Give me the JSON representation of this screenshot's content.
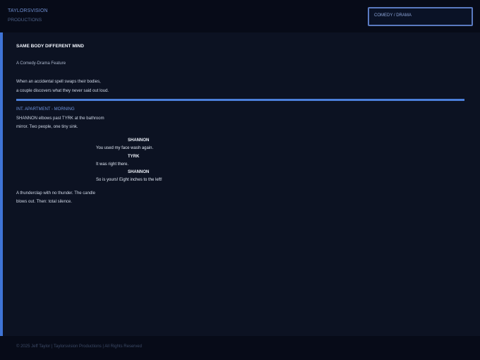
{
  "header": {
    "brand_line1": "TAYLORSVISION",
    "brand_line2": "PRODUCTIONS",
    "genre": "COMEDY / DRAMA"
  },
  "script": {
    "title": "SAME BODY DIFFERENT MIND",
    "subtitle": "A Comedy-Drama Feature",
    "logline": [
      "When an accidental spell swaps their bodies,",
      "a couple discovers what they never said out loud."
    ],
    "slugline": "INT. APARTMENT - MORNING",
    "action1": [
      "SHANNON elbows past TYRK at the bathroom",
      "mirror. Two people, one tiny sink."
    ],
    "exchanges": [
      {
        "character": "SHANNON",
        "line": "You used my face wash again."
      },
      {
        "character": "TYRK",
        "line": "It was right there."
      },
      {
        "character": "SHANNON",
        "line": "So is yours! Eight inches to the left!"
      }
    ],
    "action2": [
      "A thunderclap with no thunder. The candle",
      "blows out. Then: total silence."
    ]
  },
  "footer": {
    "copyright": "© 2025 Jeff Taylor | Taylorsvision Productions | All Rights Reserved"
  }
}
